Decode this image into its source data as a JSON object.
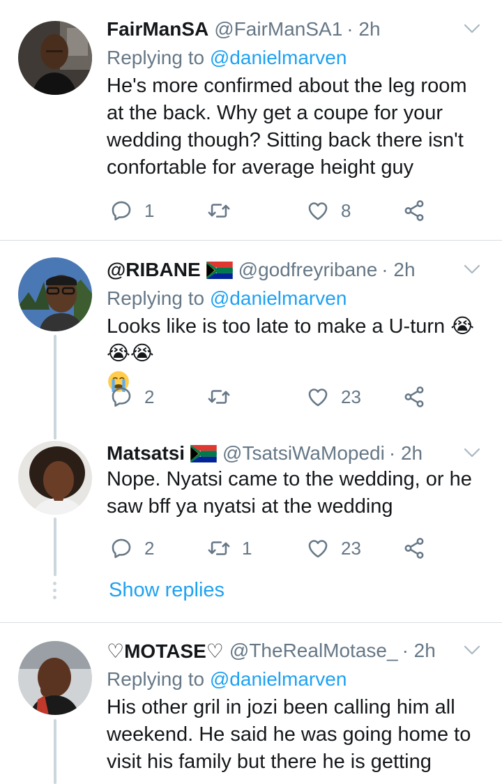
{
  "tweets": [
    {
      "name": "FairManSA",
      "handle": "@FairManSA1",
      "time": "· 2h",
      "replying_prefix": "Replying to",
      "replying_to": "@danielmarven",
      "body_lines": [
        "He's more confirmed about the leg room",
        "at the back. Why get a coupe for your",
        "wedding though? Sitting back there isn't",
        "confortable for average height guy"
      ],
      "replies": "1",
      "retweets": "",
      "likes": "8"
    },
    {
      "name": "@RIBANE",
      "handle": "@godfreyribane",
      "time": "· 2h",
      "replying_prefix": "Replying to",
      "replying_to": "@danielmarven",
      "body_lines": [
        "Looks like is too late to make a U-turn 😭😭😭"
      ],
      "replies": "2",
      "retweets": "",
      "likes": "23"
    },
    {
      "name": "Matsatsi",
      "handle": "@TsatsiWaMopedi",
      "time": "· 2h",
      "body_lines": [
        "Nope. Nyatsi came to the wedding, or he",
        "saw bff ya nyatsi at the wedding"
      ],
      "replies": "2",
      "retweets": "1",
      "likes": "23",
      "show_replies": "Show replies"
    },
    {
      "name": "♡MOTASE♡",
      "handle": "@TheRealMotase_",
      "time": "· 2h",
      "replying_prefix": "Replying to",
      "replying_to": "@danielmarven",
      "body_lines": [
        "His other gril in jozi been calling him all",
        "weekend. He said he was going home to",
        "visit his family but there he is getting"
      ]
    }
  ],
  "colors": {
    "accent": "#1da1f2",
    "muted": "#657786",
    "divider": "#d9dee3"
  },
  "icons": [
    "reply-icon",
    "retweet-icon",
    "like-icon",
    "share-icon",
    "caret-down-icon",
    "south-africa-flag-icon",
    "crying-face-emoji"
  ]
}
